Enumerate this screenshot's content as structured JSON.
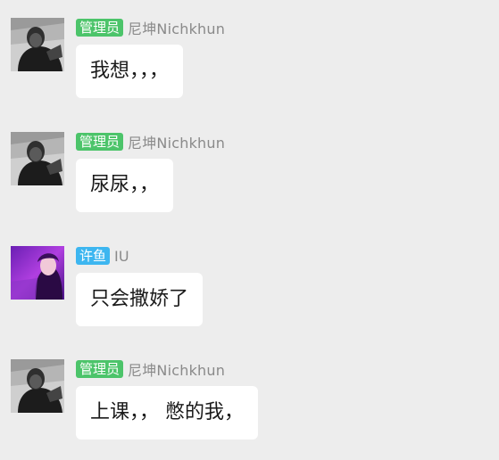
{
  "colors": {
    "background": "#ededed",
    "bubble": "#ffffff",
    "admin_badge": "#4cc46a",
    "custom_badge": "#3db6f0",
    "sender_text": "#8a8a8a"
  },
  "messages": [
    {
      "avatar": "user-avatar-nichkhun",
      "badge": "管理员",
      "sender": "尼坤Nichkhun",
      "text": "我想，，，"
    },
    {
      "avatar": "user-avatar-nichkhun",
      "badge": "管理员",
      "sender": "尼坤Nichkhun",
      "text": "尿尿，，"
    },
    {
      "avatar": "user-avatar-iu",
      "badge": "许鱼",
      "sender": "IU",
      "text": "只会撒娇了"
    },
    {
      "avatar": "user-avatar-nichkhun",
      "badge": "管理员",
      "sender": "尼坤Nichkhun",
      "text": "上课，， 憋的我，"
    }
  ]
}
